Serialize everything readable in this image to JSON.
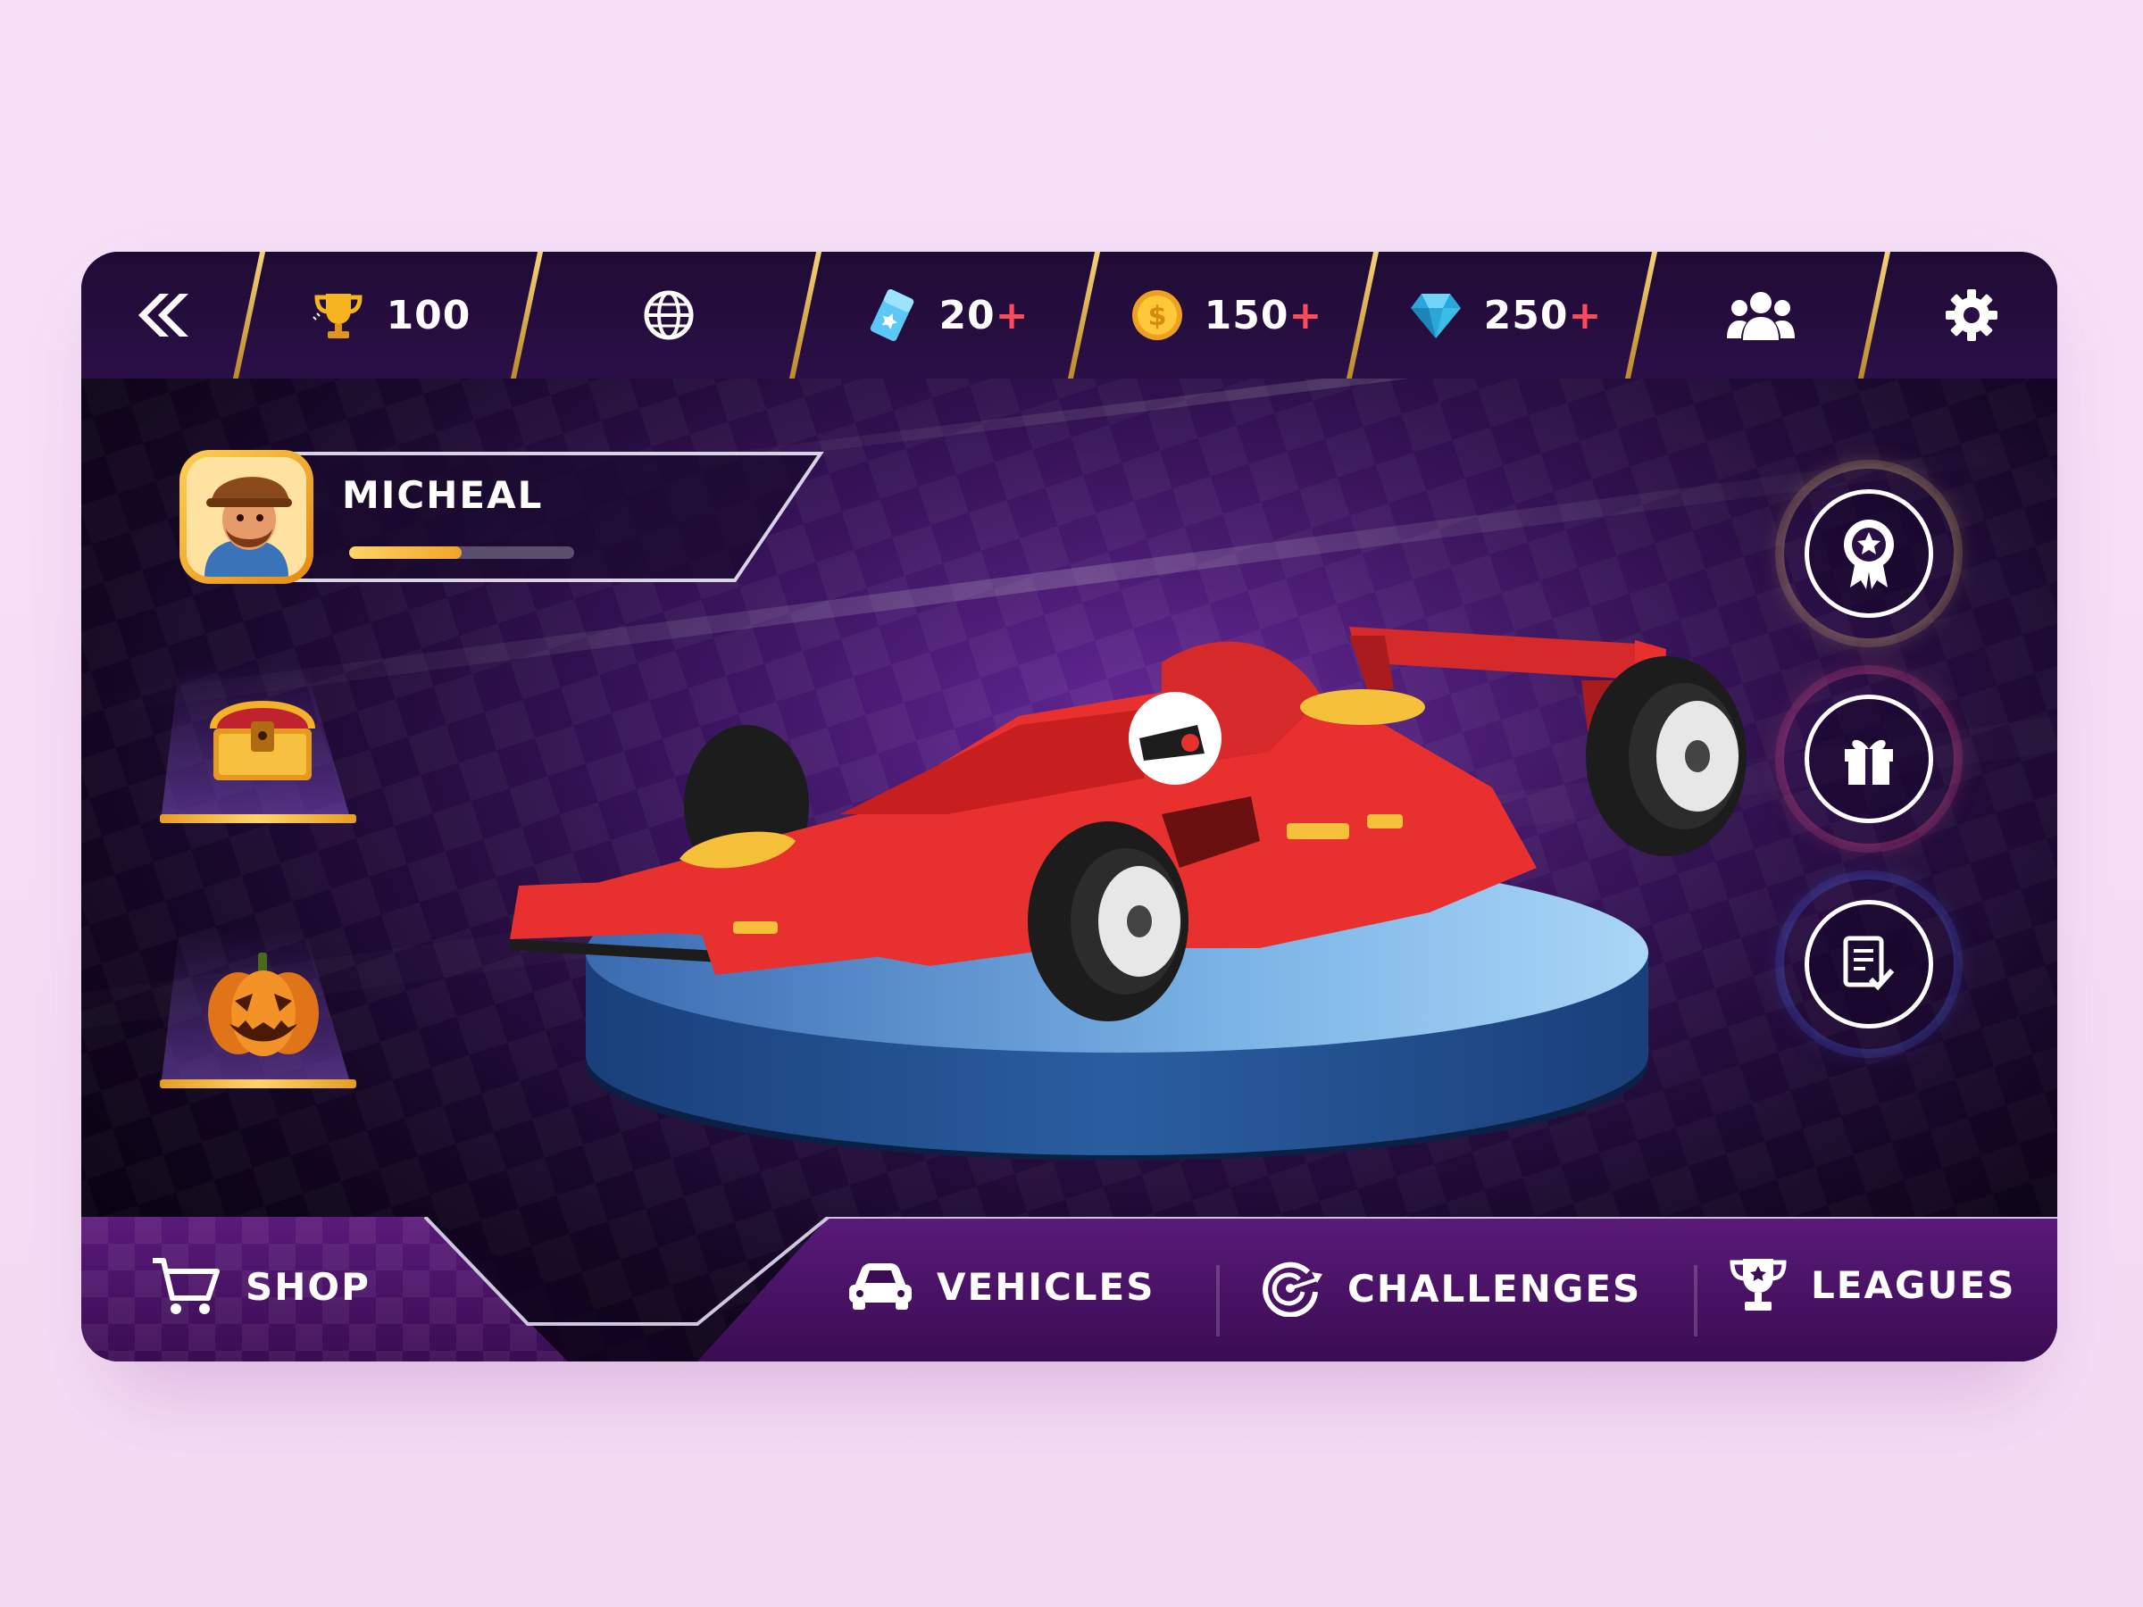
{
  "topbar": {
    "trophies": "100",
    "tickets": "20",
    "coins": "150",
    "gems": "250",
    "plus_sign": "+"
  },
  "player": {
    "name": "MICHEAL",
    "level_progress": 0.5
  },
  "nav": {
    "shop": "SHOP",
    "vehicles": "VEHICLES",
    "challenges": "CHALLENGES",
    "leagues": "LEAGUES"
  },
  "icons": [
    "back-icon",
    "trophy-icon",
    "globe-icon",
    "ticket-icon",
    "coin-icon",
    "gem-icon",
    "friends-icon",
    "gear-icon",
    "treasure-chest-icon",
    "pumpkin-icon",
    "badge-icon",
    "gift-icon",
    "tasks-icon",
    "cart-icon",
    "car-icon",
    "target-icon",
    "league-trophy-icon"
  ],
  "colors": {
    "accent_gold": "#f6d27a",
    "plus_red": "#ff4a5c",
    "car_red": "#e8312f"
  }
}
